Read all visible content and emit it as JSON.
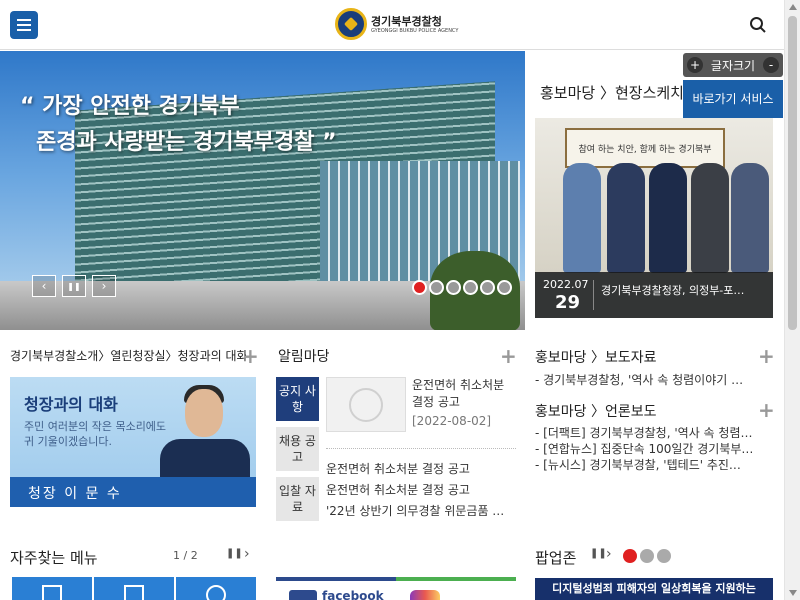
{
  "header": {
    "logo_ko": "경기북부경찰청",
    "logo_en": "GYEONGGI BUKBU POLICE AGENCY"
  },
  "hero": {
    "quote_line1": "“ 가장 안전한 경기북부",
    "quote_line2": "존경과 사랑받는 경기북부경찰 ”",
    "prev_label": "‹",
    "pause_label": "❚❚",
    "next_label": "›"
  },
  "accessibility": {
    "font_size_label": "글자크기",
    "plus": "+",
    "minus": "-",
    "shortcut_label": "바로가기 서비스"
  },
  "promo": {
    "title": "홍보마당 〉현장스케치",
    "frame_text": "참여 하는 치안, 함께 하는 경기북부",
    "date": "2022.07",
    "day": "29",
    "caption": "경기북부경찰청장, 의정부-포…"
  },
  "chief": {
    "breadcrumb": "경기북부경찰소개〉열린청장실〉청장과의 대화",
    "title": "청장과의 대화",
    "desc": "주민 여러분의 작은 목소리에도 귀 기울이겠습니다.",
    "name": "청장  이 문 수"
  },
  "notice": {
    "title": "알림마당",
    "tabs": [
      "공지 사항",
      "채용 공고",
      "입찰 자료"
    ],
    "main_title": "운전면허 취소처분 결정 공고",
    "main_date": "[2022-08-02]",
    "items": [
      "운전면허 취소처분 결정 공고",
      "운전면허 취소처분 결정 공고",
      "'22년 상반기 의무경찰 위문금품 …"
    ]
  },
  "press": {
    "title": "홍보마당 〉보도자료",
    "items": [
      "- 경기북부경찰청, '역사 속 청렴이야기 …"
    ]
  },
  "media": {
    "title": "홍보마당 〉언론보도",
    "items": [
      "- [더팩트] 경기북부경찰청, '역사 속 청렴…",
      "- [연합뉴스] 집중단속 100일간 경기북부…",
      "- [뉴시스] 경기북부경찰, '텝테드' 추진…"
    ]
  },
  "freq_menu": {
    "title": "자주찾는 메뉴",
    "pager": "1 / 2"
  },
  "sns": {
    "facebook_label": "facebook"
  },
  "popup": {
    "title": "팝업존",
    "banner": "디지털성범죄 피해자의 일상회복을 지원하는"
  },
  "colors": {
    "primary": "#1a5fa8",
    "navy": "#1f3e7c",
    "active_dot": "#e02020"
  }
}
